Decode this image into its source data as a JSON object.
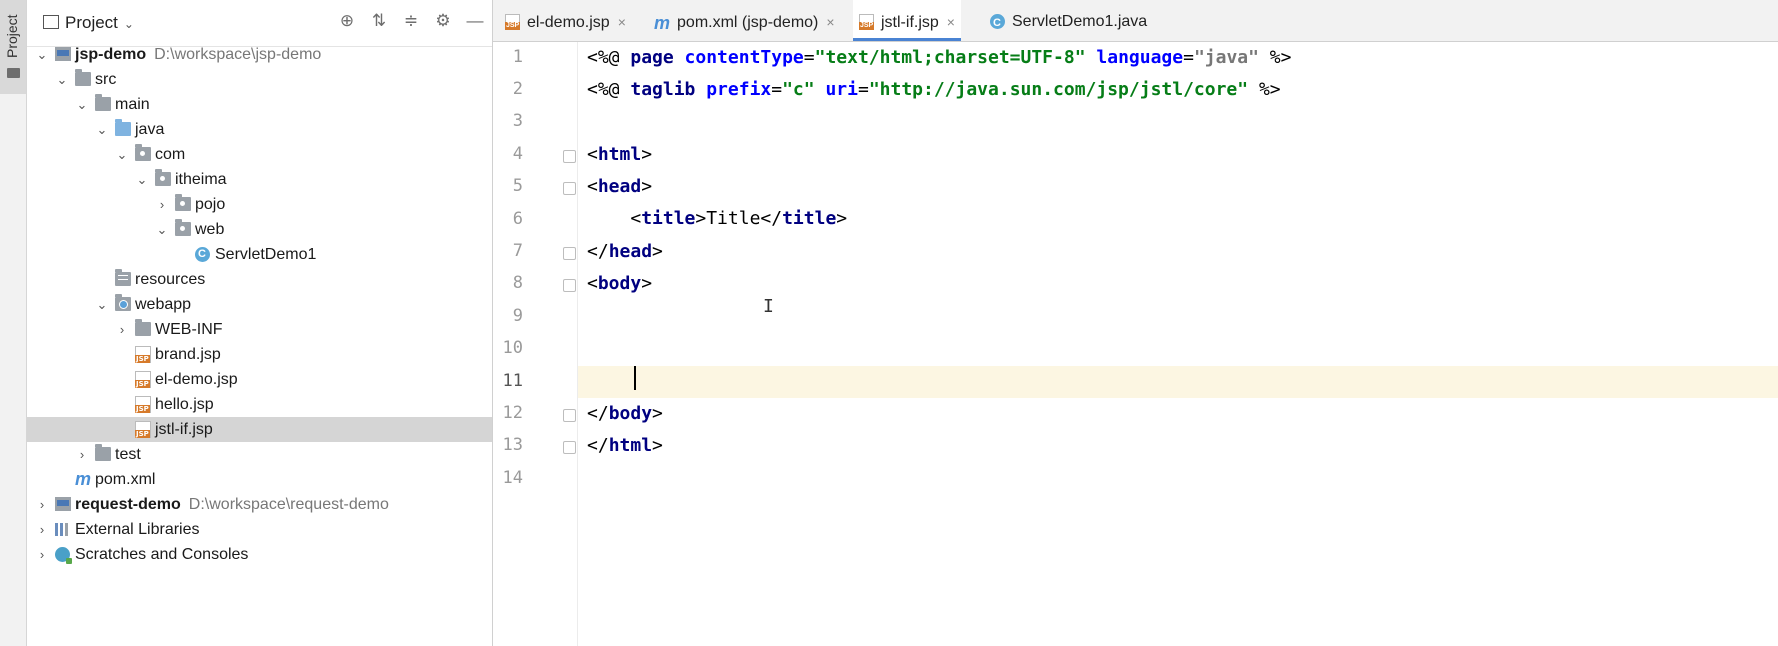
{
  "side_strip": {
    "label": "Project"
  },
  "project_panel": {
    "title": "Project",
    "header_icons": [
      "globe-icon",
      "collapse-all-icon",
      "expand-icon",
      "gear-icon",
      "minimize-icon"
    ]
  },
  "tree": [
    {
      "label": "jsp-demo",
      "path": "D:\\workspace\\jsp-demo",
      "icon": "project-folder-icon"
    },
    {
      "label": "src",
      "icon": "folder-icon"
    },
    {
      "label": "main",
      "icon": "folder-icon"
    },
    {
      "label": "java",
      "icon": "source-folder-icon"
    },
    {
      "label": "com",
      "icon": "package-icon"
    },
    {
      "label": "itheima",
      "icon": "package-icon"
    },
    {
      "label": "pojo",
      "icon": "package-icon"
    },
    {
      "label": "web",
      "icon": "package-icon"
    },
    {
      "label": "ServletDemo1",
      "icon": "class-icon"
    },
    {
      "label": "resources",
      "icon": "resources-folder-icon"
    },
    {
      "label": "webapp",
      "icon": "web-folder-icon"
    },
    {
      "label": "WEB-INF",
      "icon": "folder-icon"
    },
    {
      "label": "brand.jsp",
      "icon": "jsp-file-icon"
    },
    {
      "label": "el-demo.jsp",
      "icon": "jsp-file-icon"
    },
    {
      "label": "hello.jsp",
      "icon": "jsp-file-icon"
    },
    {
      "label": "jstl-if.jsp",
      "icon": "jsp-file-icon",
      "selected": true
    },
    {
      "label": "test",
      "icon": "folder-icon"
    },
    {
      "label": "pom.xml",
      "icon": "maven-icon"
    },
    {
      "label": "request-demo",
      "path": "D:\\workspace\\request-demo",
      "icon": "project-folder-icon"
    },
    {
      "label": "External Libraries",
      "icon": "libraries-icon"
    },
    {
      "label": "Scratches and Consoles",
      "icon": "scratches-icon"
    }
  ],
  "tabs": [
    {
      "label": "el-demo.jsp",
      "icon": "jsp-file-icon"
    },
    {
      "label": "pom.xml (jsp-demo)",
      "icon": "maven-icon"
    },
    {
      "label": "jstl-if.jsp",
      "icon": "jsp-file-icon",
      "active": true
    },
    {
      "label": "ServletDemo1.java",
      "icon": "class-icon"
    }
  ],
  "close_glyph": "×",
  "editor": {
    "line_numbers": [
      "1",
      "2",
      "3",
      "4",
      "5",
      "6",
      "7",
      "8",
      "9",
      "10",
      "11",
      "12",
      "13",
      "14"
    ],
    "current_line": "11",
    "code": {
      "l1": {
        "a": "<%@ ",
        "b": "page ",
        "c": "contentType",
        "d": "=",
        "e": "\"text/html;charset=UTF-8\"",
        "f": " ",
        "g": "language",
        "h": "=",
        "i": "\"java\"",
        "j": " %>"
      },
      "l2": {
        "a": "<%@ ",
        "b": "taglib ",
        "c": "prefix",
        "d": "=",
        "e": "\"c\"",
        "f": " ",
        "g": "uri",
        "h": "=",
        "i": "\"http://java.sun.com/jsp/jstl/core\"",
        "j": " %>"
      },
      "l4": {
        "a": "<",
        "b": "html",
        "c": ">"
      },
      "l5": {
        "a": "<",
        "b": "head",
        "c": ">"
      },
      "l6": {
        "a": "    <",
        "b": "title",
        "c": ">",
        "d": "Title",
        "e": "</",
        "f": "title",
        "g": ">"
      },
      "l7": {
        "a": "</",
        "b": "head",
        "c": ">"
      },
      "l8": {
        "a": "<",
        "b": "body",
        "c": ">"
      },
      "l12": {
        "a": "</",
        "b": "body",
        "c": ">"
      },
      "l13": {
        "a": "</",
        "b": "html",
        "c": ">"
      }
    },
    "mouse_cursor": "I"
  }
}
